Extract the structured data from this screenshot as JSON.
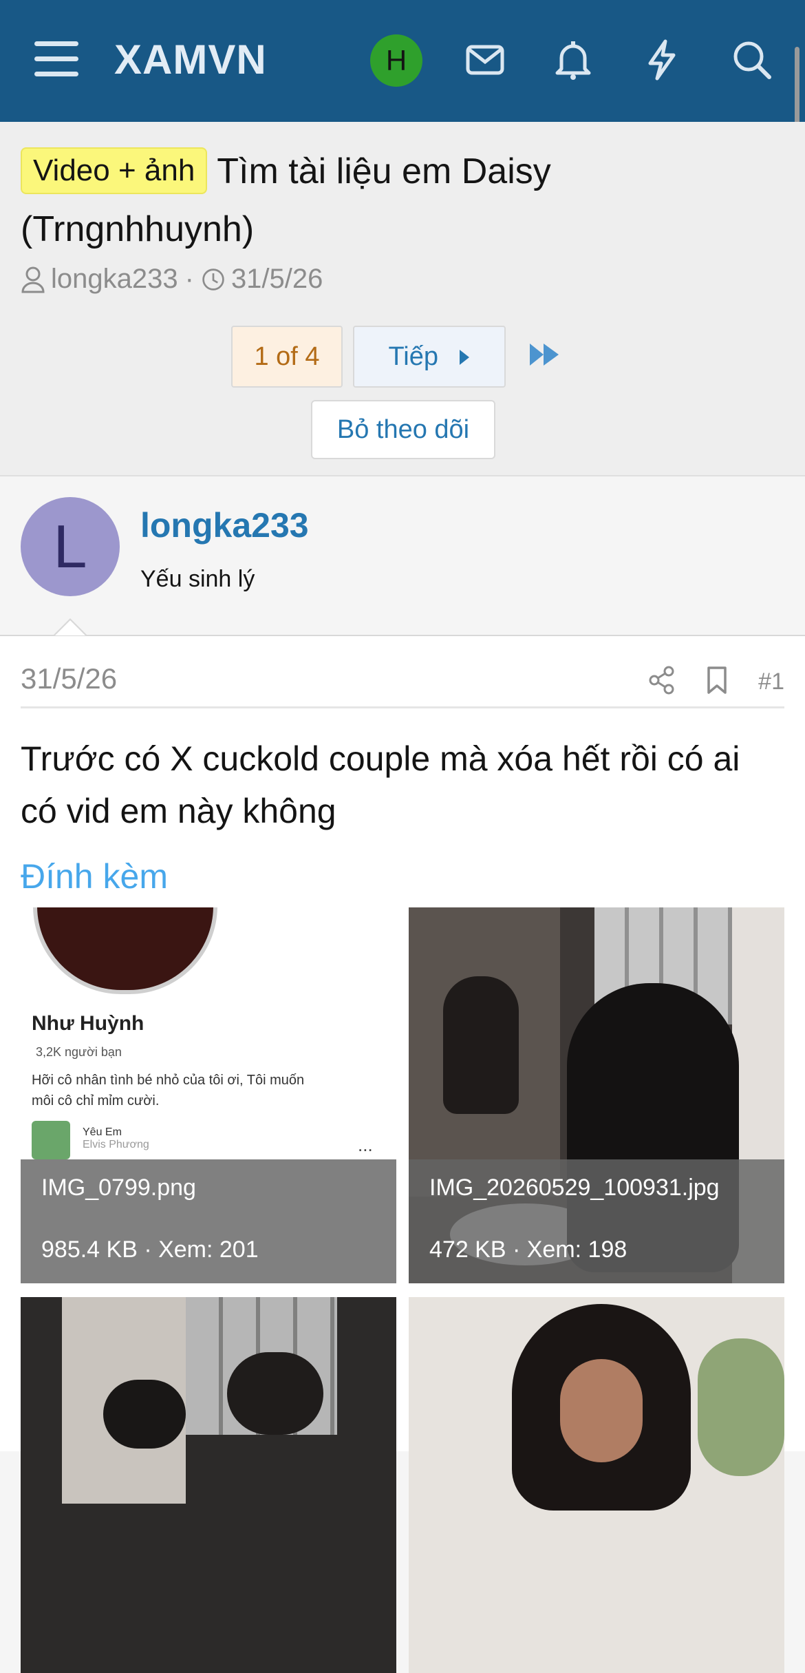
{
  "header": {
    "logo": "XAMVN",
    "user_initial": "H",
    "icons": [
      "menu-icon",
      "mail-icon",
      "bell-icon",
      "bolt-icon",
      "search-icon"
    ],
    "brand_color": "#185886"
  },
  "thread": {
    "prefix": "Video + ảnh",
    "title": "Tìm tài liệu em Daisy (Trngnhhuynh)",
    "author": "longka233",
    "meta_sep": "·",
    "date": "31/5/26",
    "pagination": {
      "current": "1 of 4",
      "next": "Tiếp"
    },
    "unwatch": "Bỏ theo dõi"
  },
  "post": {
    "author_initial": "L",
    "author_name": "longka233",
    "author_title": "Yếu sinh lý",
    "date": "31/5/26",
    "number": "#1",
    "text": "Trước có X cuckold couple mà xóa hết rồi có ai có vid em này không",
    "attachments_label": "Đính kèm",
    "attachments": [
      {
        "name": "IMG_0799.png",
        "meta": "985.4 KB · Xem: 201"
      },
      {
        "name": "IMG_20260529_100931.jpg",
        "meta": "472 KB · Xem: 198"
      }
    ],
    "screenshot_preview": {
      "name": "Như Huỳnh",
      "friends": "3,2K người bạn",
      "bio": "Hỡi cô nhân tình bé nhỏ của tôi ơi, Tôi muốn môi cô chỉ mỉm cười.",
      "badge_title": "Yêu Em",
      "badge_sub": "Elvis Phương",
      "more": "..."
    }
  }
}
